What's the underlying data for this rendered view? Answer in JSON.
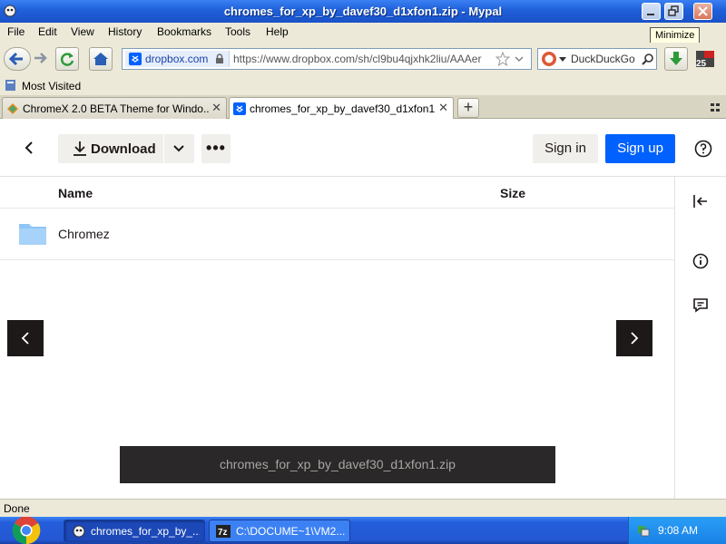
{
  "window": {
    "title": "chromes_for_xp_by_davef30_d1xfon1.zip - Mypal",
    "tooltip": "Minimize"
  },
  "menu": {
    "items": [
      "File",
      "Edit",
      "View",
      "History",
      "Bookmarks",
      "Tools",
      "Help"
    ]
  },
  "navbar": {
    "site_label": "dropbox.com",
    "url": "https://www.dropbox.com/sh/cl9bu4qjxhk2liu/AAAer",
    "search_placeholder": "DuckDuckGo",
    "badge": "25"
  },
  "bookmarks": {
    "most_visited": "Most Visited"
  },
  "tabs": [
    {
      "label": "ChromeX 2.0 BETA Theme for Windo..."
    },
    {
      "label": "chromes_for_xp_by_davef30_d1xfon1...."
    }
  ],
  "page": {
    "download_label": "Download",
    "signin_label": "Sign in",
    "signup_label": "Sign up",
    "col_name": "Name",
    "col_size": "Size",
    "files": [
      {
        "name": "Chromez",
        "type": "folder"
      }
    ],
    "file_banner": "chromes_for_xp_by_davef30_d1xfon1.zip"
  },
  "status": {
    "text": "Done"
  },
  "taskbar": {
    "items": [
      {
        "label": "chromes_for_xp_by_..."
      },
      {
        "label": "C:\\DOCUME~1\\VM2..."
      }
    ],
    "clock": "9:08 AM"
  },
  "colors": {
    "dropbox_blue": "#0061fe",
    "dark_panel": "#1e1919",
    "folder": "#8fc5f7"
  }
}
